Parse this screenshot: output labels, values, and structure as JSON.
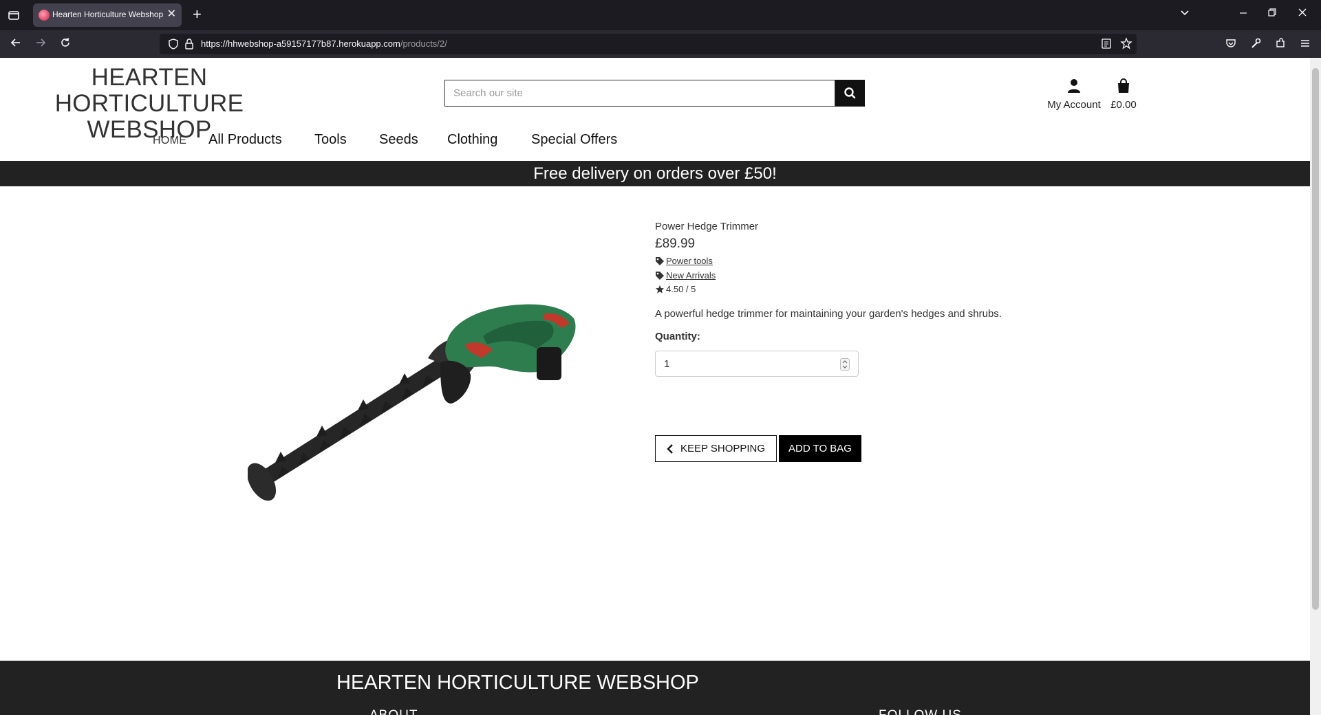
{
  "browser": {
    "tab_title": "Hearten Horticulture Webshop",
    "tab_close": "✕",
    "new_tab": "+",
    "url_host": "https://hhwebshop-a59157177b87.herokuapp.com",
    "url_path": "/products/2/"
  },
  "site": {
    "logo_line1": "HEARTEN HORTICULTURE",
    "logo_line2": "WEBSHOP",
    "search_placeholder": "Search our site",
    "account_label": "My Account",
    "bag_total": "£0.00"
  },
  "nav": {
    "home": "HOME",
    "items": [
      "All Products",
      "Tools",
      "Seeds",
      "Clothing",
      "Special Offers"
    ]
  },
  "banner": "Free delivery on orders over £50!",
  "product": {
    "name": "Power Hedge Trimmer",
    "price": "£89.99",
    "tags": [
      "Power tools",
      "New Arrivals"
    ],
    "rating": "4.50 / 5",
    "description": "A powerful hedge trimmer for maintaining your garden's hedges and shrubs.",
    "quantity_label": "Quantity:",
    "quantity_value": "1",
    "keep_shopping": "KEEP SHOPPING",
    "add_to_bag": "ADD TO BAG"
  },
  "footer": {
    "title": "HEARTEN HORTICULTURE WEBSHOP",
    "about": "ABOUT",
    "follow": "FOLLOW US"
  },
  "colors": {
    "browser_tabbar": "#1c1b22",
    "banner_bg": "#222222",
    "button_dark": "#000000",
    "product_green": "#2e7d4f"
  }
}
